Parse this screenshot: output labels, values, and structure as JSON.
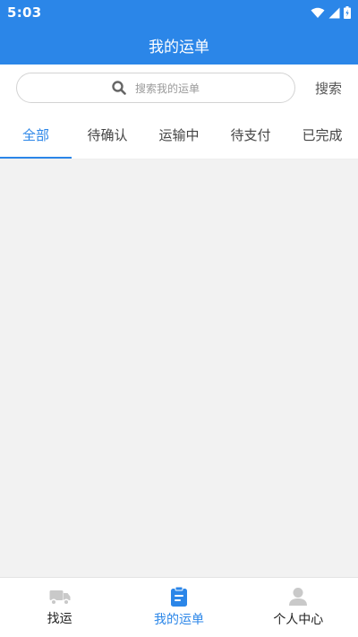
{
  "status_bar": {
    "time": "5:03"
  },
  "header": {
    "title": "我的运单"
  },
  "search": {
    "placeholder": "搜索我的运单",
    "button_label": "搜索"
  },
  "tabs": [
    {
      "label": "全部",
      "active": true
    },
    {
      "label": "待确认",
      "active": false
    },
    {
      "label": "运输中",
      "active": false
    },
    {
      "label": "待支付",
      "active": false
    },
    {
      "label": "已完成",
      "active": false
    }
  ],
  "bottom_nav": [
    {
      "label": "找运",
      "icon": "truck-icon",
      "active": false
    },
    {
      "label": "我的运单",
      "icon": "clipboard-icon",
      "active": true
    },
    {
      "label": "个人中心",
      "icon": "person-icon",
      "active": false
    }
  ],
  "colors": {
    "primary": "#2b86e8",
    "background": "#f2f2f2"
  }
}
